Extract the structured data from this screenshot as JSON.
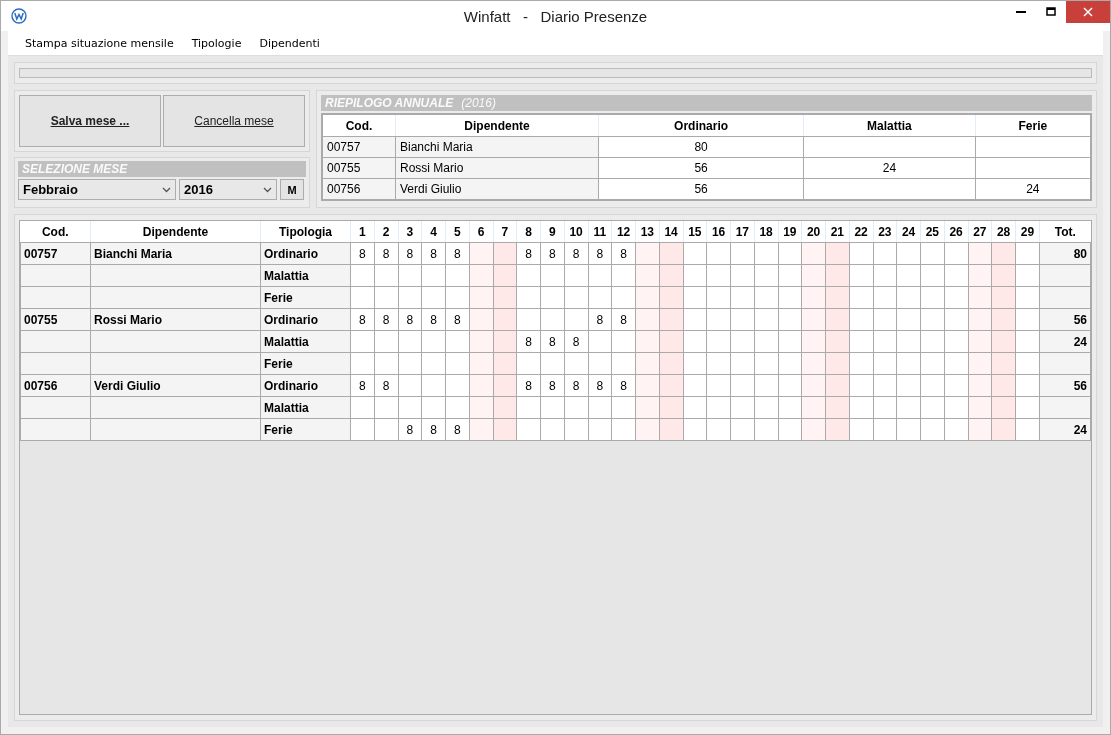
{
  "window": {
    "title": "Winfatt   -   Diario Presenze"
  },
  "menu": [
    "Stampa situazione mensile",
    "Tipologie",
    "Dipendenti"
  ],
  "progress": {
    "level": 0
  },
  "buttons": [
    {
      "label": "Salva mese ...",
      "bold": true
    },
    {
      "label": "Cancella mese",
      "bold": false
    }
  ],
  "month_selection": {
    "title": "SELEZIONE MESE",
    "month": "Febbraio",
    "year": "2016",
    "button": "M"
  },
  "summary": {
    "title": "RIEPILOGO ANNUALE",
    "year": "(2016)",
    "columns": [
      "Cod.",
      "Dipendente",
      "Ordinario",
      "Malattia",
      "Ferie"
    ],
    "rows": [
      [
        {
          "text": "00757"
        },
        {
          "text": "Bianchi Maria"
        },
        {
          "text": "80"
        },
        {},
        {}
      ],
      [
        {
          "text": "00755"
        },
        {
          "text": "Rossi Mario"
        },
        {
          "text": "56"
        },
        {
          "text": "24"
        },
        {}
      ],
      [
        {
          "text": "00756"
        },
        {
          "text": "Verdi Giulio"
        },
        {
          "text": "56"
        },
        {},
        {
          "text": "24"
        }
      ]
    ]
  },
  "attendance": {
    "columns": [
      "Cod.",
      "Dipendente",
      "Tipologia"
    ],
    "total_header": "Tot.",
    "days": [
      "1",
      "2",
      "3",
      "4",
      "5",
      "6",
      "7",
      "8",
      "9",
      "10",
      "11",
      "12",
      "13",
      "14",
      "15",
      "16",
      "17",
      "18",
      "19",
      "20",
      "21",
      "22",
      "23",
      "24",
      "25",
      "26",
      "27",
      "28",
      "29"
    ],
    "rows": [
      {
        "code": "00757",
        "name": "Bianchi Maria",
        "type": "Ordinario",
        "total": "80",
        "cells": [
          {
            "kind": "weekday",
            "value": "8"
          },
          {
            "kind": "weekday",
            "value": "8"
          },
          {
            "kind": "weekday",
            "value": "8"
          },
          {
            "kind": "weekday",
            "value": "8"
          },
          {
            "kind": "weekday",
            "value": "8"
          },
          {
            "kind": "saturday"
          },
          {
            "kind": "sunday"
          },
          {
            "kind": "weekday",
            "value": "8"
          },
          {
            "kind": "weekday",
            "value": "8"
          },
          {
            "kind": "weekday",
            "value": "8"
          },
          {
            "kind": "weekday",
            "value": "8"
          },
          {
            "kind": "weekday",
            "value": "8"
          },
          {
            "kind": "saturday"
          },
          {
            "kind": "sunday"
          },
          {
            "kind": "weekday"
          },
          {
            "kind": "weekday"
          },
          {
            "kind": "weekday"
          },
          {
            "kind": "weekday"
          },
          {
            "kind": "weekday"
          },
          {
            "kind": "saturday"
          },
          {
            "kind": "sunday"
          },
          {
            "kind": "weekday"
          },
          {
            "kind": "weekday"
          },
          {
            "kind": "weekday"
          },
          {
            "kind": "weekday"
          },
          {
            "kind": "weekday"
          },
          {
            "kind": "saturday"
          },
          {
            "kind": "sunday"
          },
          {
            "kind": "weekday"
          }
        ]
      },
      {
        "type": "Malattia",
        "cells": [
          {
            "kind": "weekday"
          },
          {
            "kind": "weekday"
          },
          {
            "kind": "weekday"
          },
          {
            "kind": "weekday"
          },
          {
            "kind": "weekday"
          },
          {
            "kind": "saturday"
          },
          {
            "kind": "sunday"
          },
          {
            "kind": "weekday"
          },
          {
            "kind": "weekday"
          },
          {
            "kind": "weekday"
          },
          {
            "kind": "weekday"
          },
          {
            "kind": "weekday"
          },
          {
            "kind": "saturday"
          },
          {
            "kind": "sunday"
          },
          {
            "kind": "weekday"
          },
          {
            "kind": "weekday"
          },
          {
            "kind": "weekday"
          },
          {
            "kind": "weekday"
          },
          {
            "kind": "weekday"
          },
          {
            "kind": "saturday"
          },
          {
            "kind": "sunday"
          },
          {
            "kind": "weekday"
          },
          {
            "kind": "weekday"
          },
          {
            "kind": "weekday"
          },
          {
            "kind": "weekday"
          },
          {
            "kind": "weekday"
          },
          {
            "kind": "saturday"
          },
          {
            "kind": "sunday"
          },
          {
            "kind": "weekday"
          }
        ]
      },
      {
        "type": "Ferie",
        "cells": [
          {
            "kind": "weekday"
          },
          {
            "kind": "weekday"
          },
          {
            "kind": "weekday"
          },
          {
            "kind": "weekday"
          },
          {
            "kind": "weekday"
          },
          {
            "kind": "saturday"
          },
          {
            "kind": "sunday"
          },
          {
            "kind": "weekday"
          },
          {
            "kind": "weekday"
          },
          {
            "kind": "weekday"
          },
          {
            "kind": "weekday"
          },
          {
            "kind": "weekday"
          },
          {
            "kind": "saturday"
          },
          {
            "kind": "sunday"
          },
          {
            "kind": "weekday"
          },
          {
            "kind": "weekday"
          },
          {
            "kind": "weekday"
          },
          {
            "kind": "weekday"
          },
          {
            "kind": "weekday"
          },
          {
            "kind": "saturday"
          },
          {
            "kind": "sunday"
          },
          {
            "kind": "weekday"
          },
          {
            "kind": "weekday"
          },
          {
            "kind": "weekday"
          },
          {
            "kind": "weekday"
          },
          {
            "kind": "weekday"
          },
          {
            "kind": "saturday"
          },
          {
            "kind": "sunday"
          },
          {
            "kind": "weekday"
          }
        ]
      },
      {
        "code": "00755",
        "name": "Rossi Mario",
        "type": "Ordinario",
        "total": "56",
        "cells": [
          {
            "kind": "weekday",
            "value": "8"
          },
          {
            "kind": "weekday",
            "value": "8"
          },
          {
            "kind": "weekday",
            "value": "8"
          },
          {
            "kind": "weekday",
            "value": "8"
          },
          {
            "kind": "weekday",
            "value": "8"
          },
          {
            "kind": "saturday"
          },
          {
            "kind": "sunday"
          },
          {
            "kind": "weekday"
          },
          {
            "kind": "weekday"
          },
          {
            "kind": "weekday"
          },
          {
            "kind": "weekday",
            "value": "8"
          },
          {
            "kind": "weekday",
            "value": "8"
          },
          {
            "kind": "saturday"
          },
          {
            "kind": "sunday"
          },
          {
            "kind": "weekday"
          },
          {
            "kind": "weekday"
          },
          {
            "kind": "weekday"
          },
          {
            "kind": "weekday"
          },
          {
            "kind": "weekday"
          },
          {
            "kind": "saturday"
          },
          {
            "kind": "sunday"
          },
          {
            "kind": "weekday"
          },
          {
            "kind": "weekday"
          },
          {
            "kind": "weekday"
          },
          {
            "kind": "weekday"
          },
          {
            "kind": "weekday"
          },
          {
            "kind": "saturday"
          },
          {
            "kind": "sunday"
          },
          {
            "kind": "weekday"
          }
        ]
      },
      {
        "type": "Malattia",
        "total": "24",
        "cells": [
          {
            "kind": "weekday"
          },
          {
            "kind": "weekday"
          },
          {
            "kind": "weekday"
          },
          {
            "kind": "weekday"
          },
          {
            "kind": "weekday"
          },
          {
            "kind": "saturday"
          },
          {
            "kind": "sunday"
          },
          {
            "kind": "weekday",
            "value": "8"
          },
          {
            "kind": "weekday",
            "value": "8"
          },
          {
            "kind": "weekday",
            "value": "8"
          },
          {
            "kind": "weekday"
          },
          {
            "kind": "weekday"
          },
          {
            "kind": "saturday"
          },
          {
            "kind": "sunday"
          },
          {
            "kind": "weekday"
          },
          {
            "kind": "weekday"
          },
          {
            "kind": "weekday"
          },
          {
            "kind": "weekday"
          },
          {
            "kind": "weekday"
          },
          {
            "kind": "saturday"
          },
          {
            "kind": "sunday"
          },
          {
            "kind": "weekday"
          },
          {
            "kind": "weekday"
          },
          {
            "kind": "weekday"
          },
          {
            "kind": "weekday"
          },
          {
            "kind": "weekday"
          },
          {
            "kind": "saturday"
          },
          {
            "kind": "sunday"
          },
          {
            "kind": "weekday"
          }
        ]
      },
      {
        "type": "Ferie",
        "cells": [
          {
            "kind": "weekday"
          },
          {
            "kind": "weekday"
          },
          {
            "kind": "weekday"
          },
          {
            "kind": "weekday"
          },
          {
            "kind": "weekday"
          },
          {
            "kind": "saturday"
          },
          {
            "kind": "sunday"
          },
          {
            "kind": "weekday"
          },
          {
            "kind": "weekday"
          },
          {
            "kind": "weekday"
          },
          {
            "kind": "weekday"
          },
          {
            "kind": "weekday"
          },
          {
            "kind": "saturday"
          },
          {
            "kind": "sunday"
          },
          {
            "kind": "weekday"
          },
          {
            "kind": "weekday"
          },
          {
            "kind": "weekday"
          },
          {
            "kind": "weekday"
          },
          {
            "kind": "weekday"
          },
          {
            "kind": "saturday"
          },
          {
            "kind": "sunday"
          },
          {
            "kind": "weekday"
          },
          {
            "kind": "weekday"
          },
          {
            "kind": "weekday"
          },
          {
            "kind": "weekday"
          },
          {
            "kind": "weekday"
          },
          {
            "kind": "saturday"
          },
          {
            "kind": "sunday"
          },
          {
            "kind": "weekday"
          }
        ]
      },
      {
        "code": "00756",
        "name": "Verdi Giulio",
        "type": "Ordinario",
        "total": "56",
        "cells": [
          {
            "kind": "weekday",
            "value": "8"
          },
          {
            "kind": "weekday",
            "value": "8"
          },
          {
            "kind": "weekday"
          },
          {
            "kind": "weekday"
          },
          {
            "kind": "weekday"
          },
          {
            "kind": "saturday"
          },
          {
            "kind": "sunday"
          },
          {
            "kind": "weekday",
            "value": "8"
          },
          {
            "kind": "weekday",
            "value": "8"
          },
          {
            "kind": "weekday",
            "value": "8"
          },
          {
            "kind": "weekday",
            "value": "8"
          },
          {
            "kind": "weekday",
            "value": "8"
          },
          {
            "kind": "saturday"
          },
          {
            "kind": "sunday"
          },
          {
            "kind": "weekday"
          },
          {
            "kind": "weekday"
          },
          {
            "kind": "weekday"
          },
          {
            "kind": "weekday"
          },
          {
            "kind": "weekday"
          },
          {
            "kind": "saturday"
          },
          {
            "kind": "sunday"
          },
          {
            "kind": "weekday"
          },
          {
            "kind": "weekday"
          },
          {
            "kind": "weekday"
          },
          {
            "kind": "weekday"
          },
          {
            "kind": "weekday"
          },
          {
            "kind": "saturday"
          },
          {
            "kind": "sunday"
          },
          {
            "kind": "weekday"
          }
        ]
      },
      {
        "type": "Malattia",
        "cells": [
          {
            "kind": "weekday"
          },
          {
            "kind": "weekday"
          },
          {
            "kind": "weekday"
          },
          {
            "kind": "weekday"
          },
          {
            "kind": "weekday"
          },
          {
            "kind": "saturday"
          },
          {
            "kind": "sunday"
          },
          {
            "kind": "weekday"
          },
          {
            "kind": "weekday"
          },
          {
            "kind": "weekday"
          },
          {
            "kind": "weekday"
          },
          {
            "kind": "weekday"
          },
          {
            "kind": "saturday"
          },
          {
            "kind": "sunday"
          },
          {
            "kind": "weekday"
          },
          {
            "kind": "weekday"
          },
          {
            "kind": "weekday"
          },
          {
            "kind": "weekday"
          },
          {
            "kind": "weekday"
          },
          {
            "kind": "saturday"
          },
          {
            "kind": "sunday"
          },
          {
            "kind": "weekday"
          },
          {
            "kind": "weekday"
          },
          {
            "kind": "weekday"
          },
          {
            "kind": "weekday"
          },
          {
            "kind": "weekday"
          },
          {
            "kind": "saturday"
          },
          {
            "kind": "sunday"
          },
          {
            "kind": "weekday"
          }
        ]
      },
      {
        "type": "Ferie",
        "total": "24",
        "cells": [
          {
            "kind": "weekday"
          },
          {
            "kind": "weekday"
          },
          {
            "kind": "weekday",
            "value": "8"
          },
          {
            "kind": "weekday",
            "value": "8"
          },
          {
            "kind": "weekday",
            "value": "8"
          },
          {
            "kind": "saturday"
          },
          {
            "kind": "sunday"
          },
          {
            "kind": "weekday"
          },
          {
            "kind": "weekday"
          },
          {
            "kind": "weekday"
          },
          {
            "kind": "weekday"
          },
          {
            "kind": "weekday"
          },
          {
            "kind": "saturday"
          },
          {
            "kind": "sunday"
          },
          {
            "kind": "weekday"
          },
          {
            "kind": "weekday"
          },
          {
            "kind": "weekday"
          },
          {
            "kind": "weekday"
          },
          {
            "kind": "weekday"
          },
          {
            "kind": "saturday"
          },
          {
            "kind": "sunday"
          },
          {
            "kind": "weekday"
          },
          {
            "kind": "weekday"
          },
          {
            "kind": "weekday"
          },
          {
            "kind": "weekday"
          },
          {
            "kind": "weekday"
          },
          {
            "kind": "saturday"
          },
          {
            "kind": "sunday"
          },
          {
            "kind": "weekday"
          }
        ]
      }
    ]
  }
}
